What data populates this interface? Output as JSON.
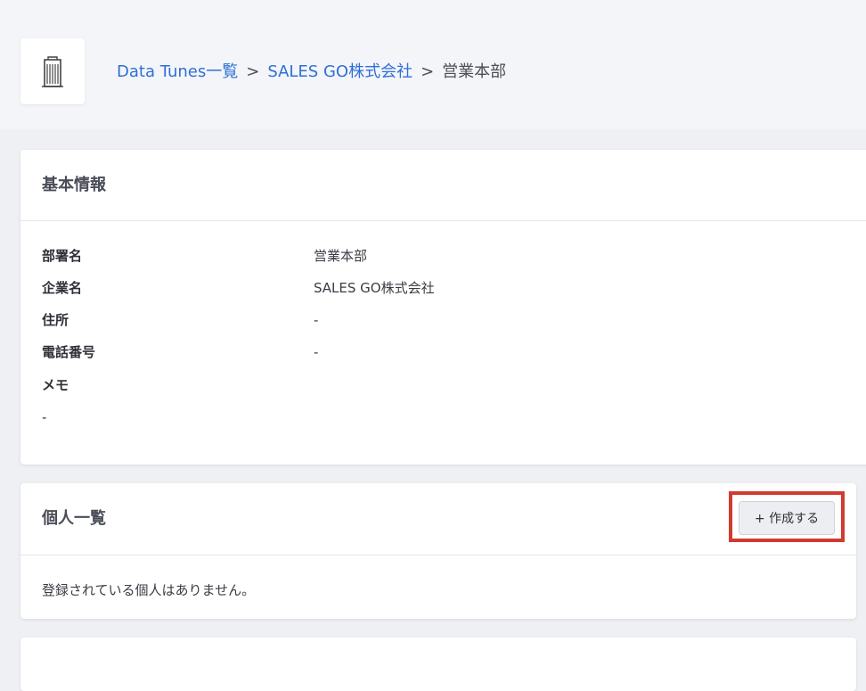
{
  "breadcrumb": {
    "items": [
      {
        "label": "Data Tunes一覧"
      },
      {
        "label": "SALES GO株式会社"
      }
    ],
    "separator": ">",
    "current": "営業本部"
  },
  "basic_info": {
    "title": "基本情報",
    "rows": [
      {
        "label": "部署名",
        "value": "営業本部"
      },
      {
        "label": "企業名",
        "value": "SALES GO株式会社"
      },
      {
        "label": "住所",
        "value": "-"
      },
      {
        "label": "電話番号",
        "value": "-"
      },
      {
        "label": "メモ",
        "value": ""
      }
    ],
    "memo_value": "-"
  },
  "people": {
    "title": "個人一覧",
    "create_label": "+ 作成する",
    "empty_message": "登録されている個人はありません。"
  },
  "icons": {
    "logo": "building-icon"
  },
  "colors": {
    "link": "#2f6fd7",
    "highlight": "#d13a2f",
    "header_bg": "#f4f5f8",
    "page_bg": "#eef0f3"
  }
}
